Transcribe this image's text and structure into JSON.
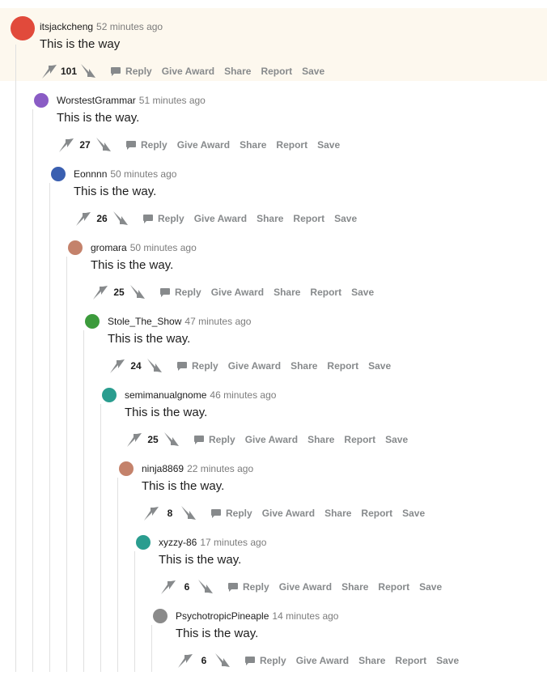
{
  "actions": {
    "reply": "Reply",
    "give_award": "Give Award",
    "share": "Share",
    "report": "Report",
    "save": "Save"
  },
  "comments": [
    {
      "user": "itsjackcheng",
      "time": "52 minutes ago",
      "text": "This is the way",
      "score": "101",
      "avatar_color": "#e14a3b",
      "highlighted": true
    },
    {
      "user": "WorstestGrammar",
      "time": "51 minutes ago",
      "text": "This is the way.",
      "score": "27",
      "avatar_color": "#8a5cc5"
    },
    {
      "user": "Eonnnn",
      "time": "50 minutes ago",
      "text": "This is the way.",
      "score": "26",
      "avatar_color": "#3a5fb0"
    },
    {
      "user": "gromara",
      "time": "50 minutes ago",
      "text": "This is the way.",
      "score": "25",
      "avatar_color": "#c4826b"
    },
    {
      "user": "Stole_The_Show",
      "time": "47 minutes ago",
      "text": "This is the way.",
      "score": "24",
      "avatar_color": "#3c9b3c"
    },
    {
      "user": "semimanualgnome",
      "time": "46 minutes ago",
      "text": "This is the way.",
      "score": "25",
      "avatar_color": "#2a9d8f"
    },
    {
      "user": "ninja8869",
      "time": "22 minutes ago",
      "text": "This is the way.",
      "score": "8",
      "avatar_color": "#c4826b"
    },
    {
      "user": "xyzzy-86",
      "time": "17 minutes ago",
      "text": "This is the way.",
      "score": "6",
      "avatar_color": "#2a9d8f"
    },
    {
      "user": "PsychotropicPineaple",
      "time": "14 minutes ago",
      "text": "This is the way.",
      "score": "6",
      "avatar_color": "#8a8a8a"
    }
  ]
}
